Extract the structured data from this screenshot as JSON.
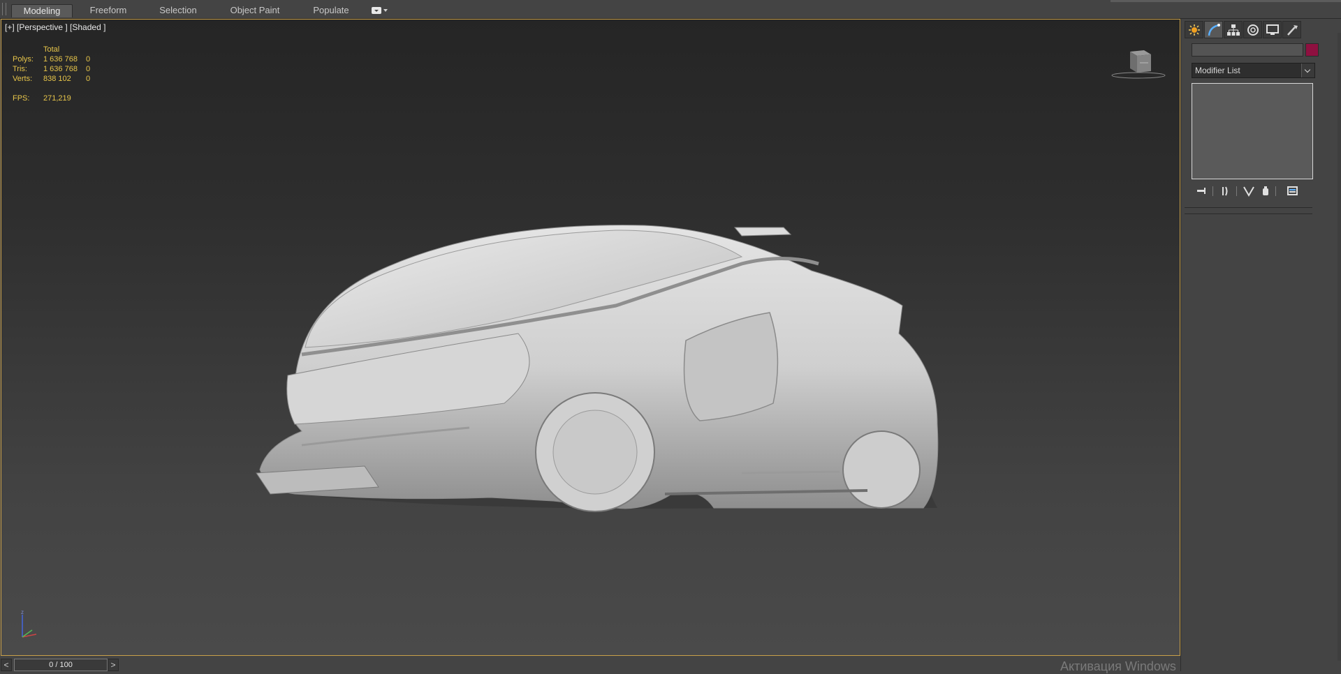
{
  "ribbon": {
    "tabs": [
      "Modeling",
      "Freeform",
      "Selection",
      "Object Paint",
      "Populate"
    ],
    "active_tab": "Modeling",
    "options_icon": "options-dropdown-icon"
  },
  "viewport": {
    "label": "[+] [Perspective ] [Shaded ]",
    "stats": {
      "header": "Total",
      "polys_label": "Polys:",
      "polys_total": "1 636 768",
      "polys_sel": "0",
      "tris_label": "Tris:",
      "tris_total": "1 636 768",
      "tris_sel": "0",
      "verts_label": "Verts:",
      "verts_total": "838 102",
      "verts_sel": "0",
      "fps_label": "FPS:",
      "fps_value": "271,219"
    },
    "border_color": "#c9a04a",
    "stats_color": "#e8c64a",
    "subject": "3d-vehicle-model"
  },
  "command_panel": {
    "tabs": [
      "create-icon",
      "modify-icon",
      "hierarchy-icon",
      "motion-icon",
      "display-icon",
      "utilities-icon"
    ],
    "active_tab": "modify-icon",
    "object_name": "",
    "object_color": "#8f1040",
    "modifier_list_label": "Modifier List",
    "stack_tools": [
      "pin-stack-icon",
      "show-end-result-icon",
      "make-unique-icon",
      "remove-modifier-icon",
      "configure-modifier-sets-icon"
    ]
  },
  "timeline": {
    "prev": "<",
    "next": ">",
    "frame": "0 / 100"
  },
  "watermark": "Активация Windows"
}
